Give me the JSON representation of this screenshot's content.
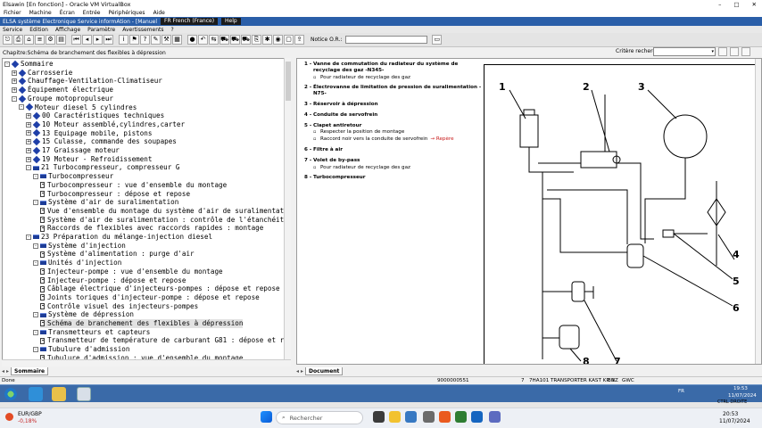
{
  "vbox": {
    "title": "Elsawin [En fonction] - Oracle VM VirtualBox",
    "menu": [
      "Fichier",
      "Machine",
      "Écran",
      "Entrée",
      "Périphériques",
      "Aide"
    ],
    "controls": [
      "–",
      "□",
      "✕"
    ]
  },
  "app": {
    "title": "ELSA système Electronique Service informAtion - [Manuel",
    "lang_badge": "FR French (France)",
    "help_badge": "Help",
    "menu": [
      "Service",
      "Edition",
      "Affichage",
      "Paramètre",
      "Avertissements",
      "?"
    ],
    "ordre_label": "Notice O.R.:",
    "chapter": "Chapitre:Schéma de branchement des flexibles à dépression",
    "criteria_label": "Critère recherche:"
  },
  "toolbar_icons": [
    "exit-icon",
    "print-icon",
    "home-icon",
    "list-icon",
    "gear-icon",
    "book-icon",
    "first-icon",
    "prev-icon",
    "next-icon",
    "last-icon",
    "info-icon",
    "help-icon",
    "question-icon",
    "note-icon",
    "tool-icon",
    "document-icon",
    "stop-icon",
    "back-icon",
    "nav-icon",
    "car-icon",
    "car-green-icon",
    "car-blue-icon",
    "clip-icon",
    "settings-icon",
    "camera-icon",
    "page-icon",
    "export-icon"
  ],
  "tree": {
    "nodes": [
      {
        "label": "Sommaire",
        "level": 0,
        "exp": "-",
        "icon": "bk"
      },
      {
        "label": "Carrosserie",
        "level": 1,
        "exp": "+",
        "icon": "bk"
      },
      {
        "label": "Chauffage-Ventilation-Climatiseur",
        "level": 1,
        "exp": "+",
        "icon": "bk"
      },
      {
        "label": "Équipement électrique",
        "level": 1,
        "exp": "+",
        "icon": "bk"
      },
      {
        "label": "Groupe motopropulseur",
        "level": 1,
        "exp": "-",
        "icon": "bk"
      },
      {
        "label": "Moteur diesel 5 cylindres",
        "level": 2,
        "exp": "-",
        "icon": "bk"
      },
      {
        "label": "00 Caractéristiques techniques",
        "level": 3,
        "exp": "+",
        "icon": "bk"
      },
      {
        "label": "10 Moteur assemblé,cylindres,carter",
        "level": 3,
        "exp": "+",
        "icon": "bk"
      },
      {
        "label": "13 Equipage mobile, pistons",
        "level": 3,
        "exp": "+",
        "icon": "bk"
      },
      {
        "label": "15 Culasse, commande des soupapes",
        "level": 3,
        "exp": "+",
        "icon": "bk"
      },
      {
        "label": "17 Graissage moteur",
        "level": 3,
        "exp": "+",
        "icon": "bk"
      },
      {
        "label": "19 Moteur - Refroidissement",
        "level": 3,
        "exp": "+",
        "icon": "bk"
      },
      {
        "label": "21 Turbocompresseur, compresseur G",
        "level": 3,
        "exp": "-",
        "icon": "fold"
      },
      {
        "label": "Turbocompresseur",
        "level": 4,
        "exp": "-",
        "icon": "fold"
      },
      {
        "label": "Turbocompresseur : vue d'ensemble du montage",
        "level": 5,
        "exp": "",
        "icon": "pg"
      },
      {
        "label": "Turbocompresseur : dépose et repose",
        "level": 5,
        "exp": "",
        "icon": "pg"
      },
      {
        "label": "Système d'air de suralimentation",
        "level": 4,
        "exp": "-",
        "icon": "fold"
      },
      {
        "label": "Vue d'ensemble du montage du système d'air de suralimentat",
        "level": 5,
        "exp": "",
        "icon": "pg"
      },
      {
        "label": "Système d'air de suralimentation : contrôle de l'étanchéit",
        "level": 5,
        "exp": "",
        "icon": "pg"
      },
      {
        "label": "Raccords de flexibles avec raccords rapides : montage",
        "level": 5,
        "exp": "",
        "icon": "pg"
      },
      {
        "label": "23 Préparation du mélange-injection diesel",
        "level": 3,
        "exp": "-",
        "icon": "fold"
      },
      {
        "label": "Système d'injection",
        "level": 4,
        "exp": "-",
        "icon": "fold"
      },
      {
        "label": "Système d'alimentation : purge d'air",
        "level": 5,
        "exp": "",
        "icon": "pg"
      },
      {
        "label": "Unités d'injection",
        "level": 4,
        "exp": "-",
        "icon": "fold"
      },
      {
        "label": "Injecteur-pompe : vue d'ensemble du montage",
        "level": 5,
        "exp": "",
        "icon": "pg"
      },
      {
        "label": "Injecteur-pompe : dépose et repose",
        "level": 5,
        "exp": "",
        "icon": "pg"
      },
      {
        "label": "Câblage électrique d'injecteurs-pompes : dépose et repose",
        "level": 5,
        "exp": "",
        "icon": "pg"
      },
      {
        "label": "Joints toriques d'injecteur-pompe : dépose et repose",
        "level": 5,
        "exp": "",
        "icon": "pg"
      },
      {
        "label": "Contrôle visuel des injecteurs-pompes",
        "level": 5,
        "exp": "",
        "icon": "pg"
      },
      {
        "label": "Système de dépression",
        "level": 4,
        "exp": "-",
        "icon": "fold"
      },
      {
        "label": "Schéma de branchement des flexibles à dépression",
        "level": 5,
        "exp": "",
        "icon": "pg",
        "selected": true
      },
      {
        "label": "Transmetteurs et capteurs",
        "level": 4,
        "exp": "-",
        "icon": "fold"
      },
      {
        "label": "Transmetteur de température de carburant G81 : dépose et r",
        "level": 5,
        "exp": "",
        "icon": "pg"
      },
      {
        "label": "Tubulure d'admission",
        "level": 4,
        "exp": "-",
        "icon": "fold"
      },
      {
        "label": "Tubulure d'admission : vue d'ensemble du montage",
        "level": 5,
        "exp": "",
        "icon": "pg"
      }
    ]
  },
  "tabs": {
    "left": "Sommaire",
    "right": "Document"
  },
  "legend": [
    {
      "num": "1 -",
      "label": "Vanne de commutation du radiateur du système de recyclage des gaz -N345-",
      "subs": [
        {
          "text": "Pour radiateur de recyclage des gaz",
          "link": ""
        }
      ]
    },
    {
      "num": "2 -",
      "label": "Électrovanne de limitation de pression de suralimentation -N75-",
      "subs": []
    },
    {
      "num": "3 -",
      "label": "Réservoir à dépression",
      "subs": []
    },
    {
      "num": "4 -",
      "label": "Conduite de servofrein",
      "subs": []
    },
    {
      "num": "5 -",
      "label": "Clapet antiretour",
      "subs": [
        {
          "text": "Respecter la position de montage",
          "link": ""
        },
        {
          "text": "Raccord noir vers la conduite de servofrein",
          "link": "→ Repère"
        }
      ]
    },
    {
      "num": "6 -",
      "label": "Filtre à air",
      "subs": []
    },
    {
      "num": "7 -",
      "label": "Volet de by-pass",
      "subs": [
        {
          "text": "Pour radiateur de recyclage des gaz",
          "link": ""
        }
      ]
    },
    {
      "num": "8 -",
      "label": "Turbocompresseur",
      "subs": []
    }
  ],
  "diagram_labels": [
    "1",
    "2",
    "3",
    "4",
    "5",
    "6",
    "7",
    "8"
  ],
  "status": {
    "left": "Done",
    "field1": "9000000551",
    "field2": "7",
    "field3": "7HA101",
    "field4": "TRANSPORTER KAST KR 9",
    "field5": "BNZ",
    "field6": "GWC"
  },
  "win7": {
    "lang": "FR",
    "time": "19:53",
    "date": "11/07/2024"
  },
  "win11": {
    "ticker_name": "EUR/GBP",
    "ticker_change": "-0,18%",
    "search_placeholder": "Rechercher",
    "time": "20:53",
    "date": "11/07/2024",
    "hint": "CTRL DROITE"
  },
  "colors": {
    "link": "#c81919",
    "vbox_accent": "#2a5ea8"
  }
}
